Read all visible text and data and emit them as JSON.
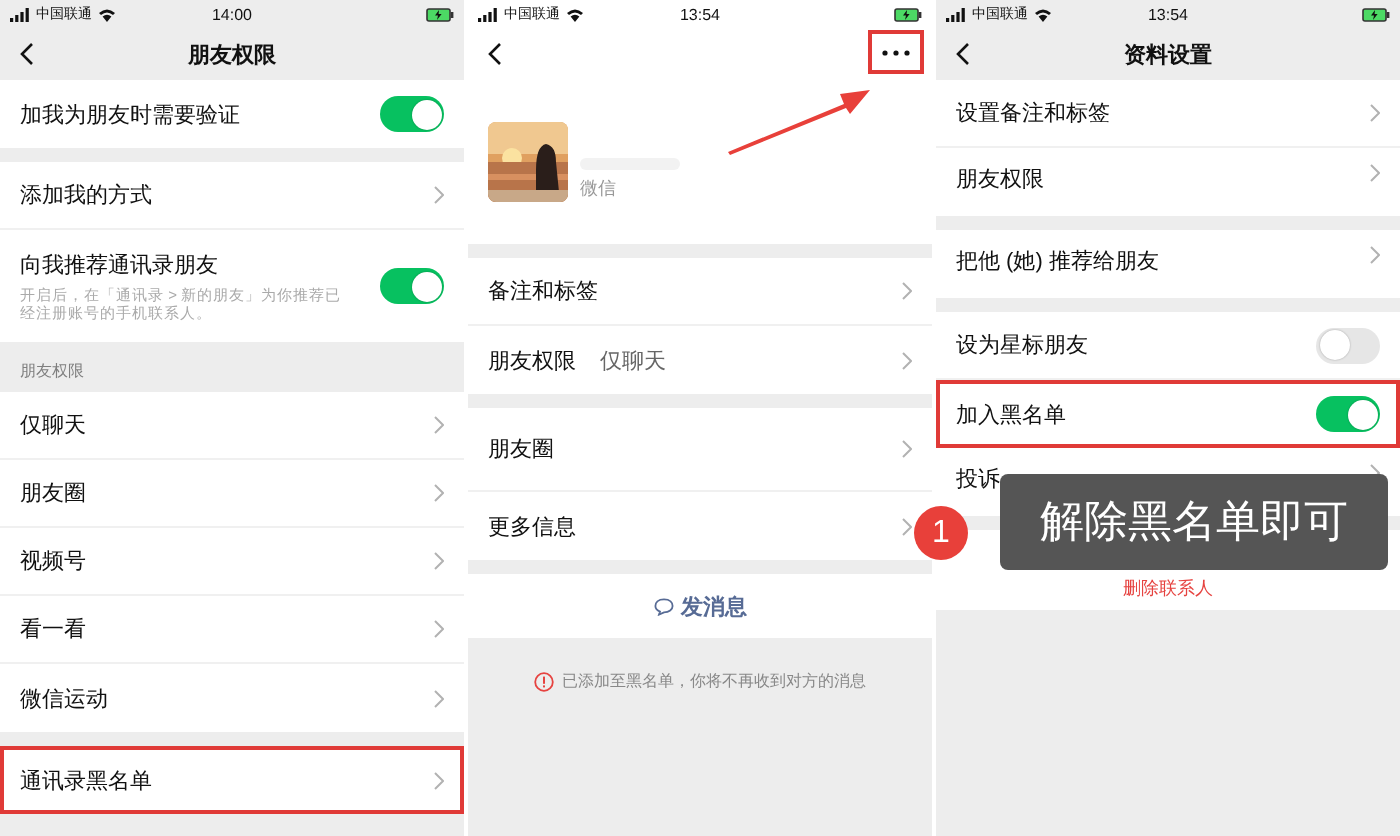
{
  "screens": [
    {
      "status_bar": {
        "carrier": "中国联通",
        "time": "14:00"
      },
      "nav": {
        "title": "朋友权限"
      },
      "groups": [
        {
          "rows": [
            {
              "kind": "toggle",
              "label": "加我为朋友时需要验证",
              "on": true,
              "highlighted": false
            }
          ]
        },
        {
          "rows": [
            {
              "kind": "link",
              "label": "添加我的方式",
              "highlighted": false
            },
            {
              "kind": "toggle",
              "label": "向我推荐通讯录朋友",
              "subtitle": "开启后，在「通讯录 > 新的朋友」为你推荐已经注册账号的手机联系人。",
              "on": true,
              "highlighted": false
            }
          ]
        },
        {
          "header": "朋友权限",
          "rows": [
            {
              "kind": "link",
              "label": "仅聊天",
              "highlighted": false
            },
            {
              "kind": "link",
              "label": "朋友圈",
              "highlighted": false
            },
            {
              "kind": "link",
              "label": "视频号",
              "highlighted": false
            },
            {
              "kind": "link",
              "label": "看一看",
              "highlighted": false
            },
            {
              "kind": "link",
              "label": "微信运动",
              "highlighted": false
            }
          ]
        },
        {
          "rows": [
            {
              "kind": "link",
              "label": "通讯录黑名单",
              "highlighted": true
            }
          ]
        }
      ]
    },
    {
      "status_bar": {
        "carrier": "中国联通",
        "time": "13:54"
      },
      "nav": {
        "more_button": {
          "highlighted": true
        }
      },
      "profile": {
        "id_label": "微信"
      },
      "groups": [
        {
          "rows": [
            {
              "kind": "link",
              "label": "备注和标签",
              "highlighted": false
            },
            {
              "kind": "link",
              "label": "朋友权限",
              "value": "仅聊天",
              "highlighted": false
            }
          ]
        },
        {
          "rows": [
            {
              "kind": "album",
              "label": "朋友圈",
              "highlighted": false
            },
            {
              "kind": "link",
              "label": "更多信息",
              "highlighted": false
            }
          ]
        },
        {
          "rows": [
            {
              "kind": "action",
              "label": "发消息",
              "highlighted": false
            }
          ]
        }
      ],
      "notice": "已添加至黑名单，你将不再收到对方的消息"
    },
    {
      "status_bar": {
        "carrier": "中国联通",
        "time": "13:54"
      },
      "nav": {
        "title": "资料设置"
      },
      "groups": [
        {
          "rows": [
            {
              "kind": "link",
              "label": "设置备注和标签",
              "highlighted": false
            },
            {
              "kind": "link",
              "label": "朋友权限",
              "highlighted": false
            }
          ]
        },
        {
          "rows": [
            {
              "kind": "link",
              "label": "把他 (她) 推荐给朋友",
              "highlighted": false
            }
          ]
        },
        {
          "rows": [
            {
              "kind": "toggle",
              "label": "设为星标朋友",
              "on": false,
              "highlighted": false
            },
            {
              "kind": "toggle",
              "label": "加入黑名单",
              "on": true,
              "highlighted": true
            },
            {
              "kind": "link",
              "label": "投诉",
              "highlighted": false
            }
          ]
        },
        {
          "rows": [
            {
              "kind": "danger",
              "label": "删除联系人",
              "highlighted": false
            }
          ]
        }
      ],
      "annotation": {
        "number": "1",
        "text": "解除黑名单即可"
      }
    }
  ]
}
